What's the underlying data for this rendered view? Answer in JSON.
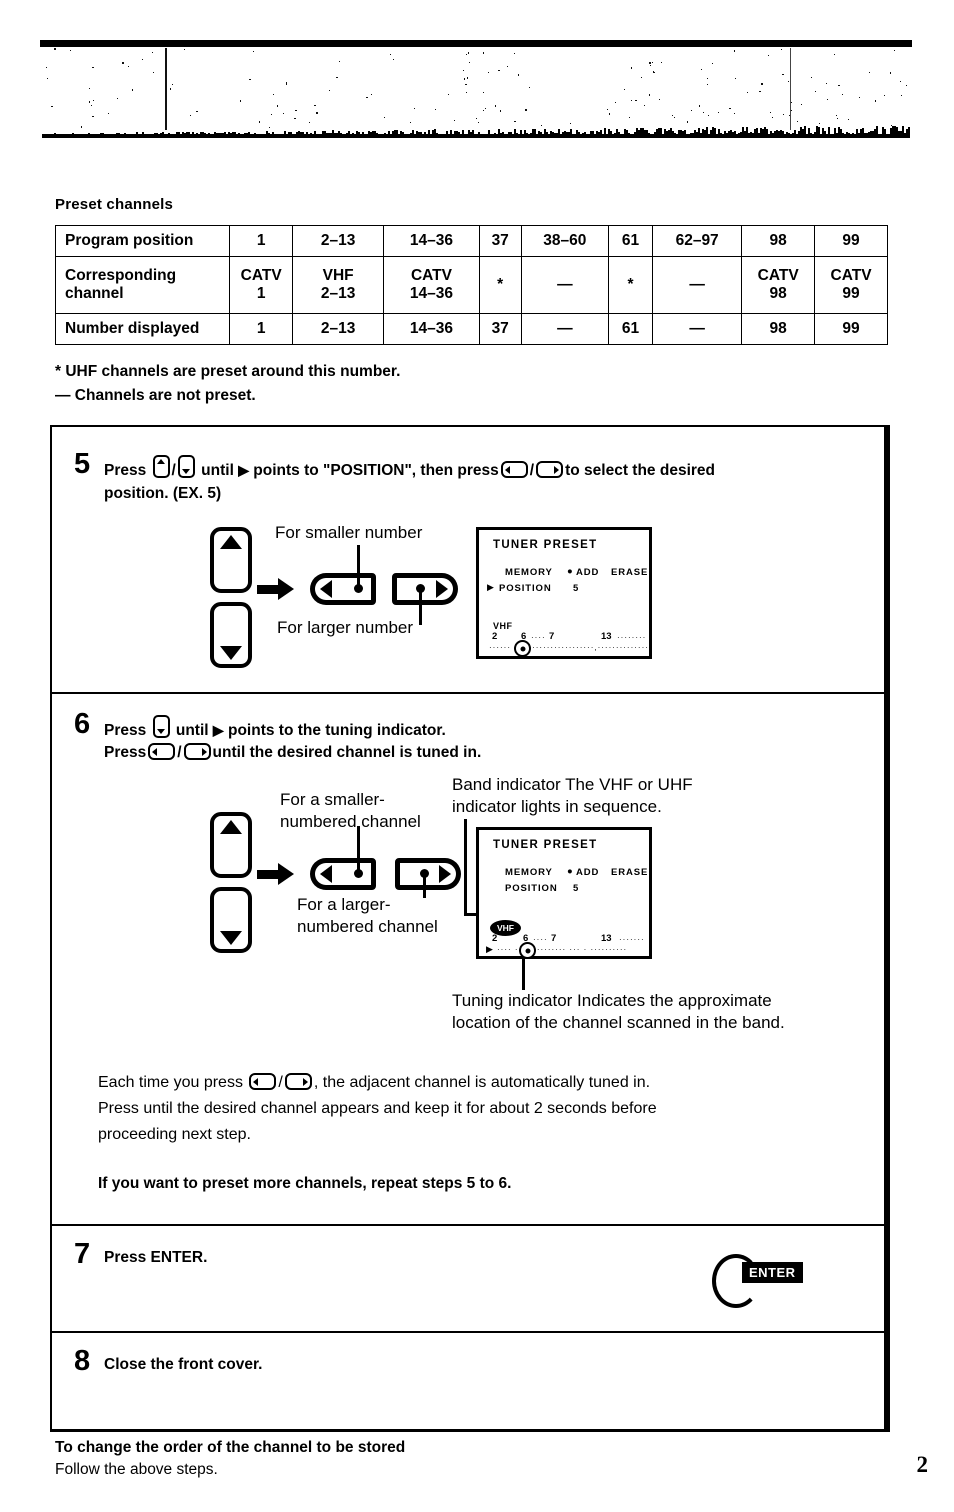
{
  "section": {
    "heading": "Preset channels"
  },
  "preset_table": {
    "rows": [
      {
        "label": "Program position",
        "cells": [
          "1",
          "2–13",
          "14–36",
          "37",
          "38–60",
          "61",
          "62–97",
          "98",
          "99"
        ]
      },
      {
        "label": "Corresponding channel",
        "label_line1": "Corresponding",
        "label_line2": "channel",
        "cells": [
          {
            "line1": "CATV",
            "line2": "1"
          },
          {
            "line1": "VHF",
            "line2": "2–13"
          },
          {
            "line1": "CATV",
            "line2": "14–36"
          },
          {
            "line1": "*",
            "line2": ""
          },
          {
            "line1": "—",
            "line2": ""
          },
          {
            "line1": "*",
            "line2": ""
          },
          {
            "line1": "—",
            "line2": ""
          },
          {
            "line1": "CATV",
            "line2": "98"
          },
          {
            "line1": "CATV",
            "line2": "99"
          }
        ]
      },
      {
        "label": "Number displayed",
        "cells": [
          "1",
          "2–13",
          "14–36",
          "37",
          "—",
          "61",
          "—",
          "98",
          "99"
        ]
      }
    ]
  },
  "footnotes": [
    "*  UHF channels are preset around this number.",
    "— Channels are not preset."
  ],
  "steps": {
    "step5": {
      "number": "5",
      "text_part1": "Press",
      "text_part2": "until",
      "text_part3": "points to \"POSITION\", then press",
      "text_part4": "to select the desired",
      "text_line2": "position. (EX. 5)",
      "caption_smaller": "For smaller number",
      "caption_larger": "For larger number",
      "osd": {
        "title": "TUNER  PRESET",
        "memory_label": "MEMORY",
        "add_label": "ADD",
        "erase_label": "ERASE",
        "position_label": "POSITION",
        "position_value": "5",
        "pointer": "▶",
        "band_label": "VHF",
        "scale": [
          "2",
          "6",
          "7",
          "13"
        ]
      }
    },
    "step6": {
      "number": "6",
      "text_line1_a": "Press",
      "text_line1_b": "until",
      "text_line1_c": "points to the tuning indicator.",
      "text_line2_a": "Press",
      "text_line2_b": "until the desired channel is tuned in.",
      "caption_band": "Band indicator The VHF or UHF\nindicator lights in sequence.",
      "caption_band_line1": "Band indicator The VHF or UHF",
      "caption_band_line2": "indicator lights in sequence.",
      "caption_smaller_line1": "For a smaller-",
      "caption_smaller_line2": "numbered channel",
      "caption_larger_line1": "For a larger-",
      "caption_larger_line2": "numbered channel",
      "caption_tuning_line1": "Tuning indicator Indicates the approximate",
      "caption_tuning_line2": "location of the channel scanned in the band.",
      "osd": {
        "title": "TUNER  PRESET",
        "memory_label": "MEMORY",
        "add_label": "ADD",
        "erase_label": "ERASE",
        "position_label": "POSITION",
        "position_value": "5",
        "pointer": "▶",
        "band_label": "VHF",
        "scale": [
          "2",
          "6",
          "7",
          "13"
        ]
      },
      "paragraph_line1_a": "Each time you press",
      "paragraph_line1_b": ", the adjacent channel is automatically tuned in.",
      "paragraph_line2": "Press until the desired channel appears and keep it for about 2 seconds before",
      "paragraph_line3": "proceeding next step.",
      "note_bold": "If you want to preset more channels, repeat steps 5 to 6."
    },
    "step7": {
      "number": "7",
      "text": "Press ENTER.",
      "enter_label": "ENTER"
    },
    "step8": {
      "number": "8",
      "text": "Close the front cover."
    }
  },
  "footer": {
    "line1": "To change the order of the channel to be stored",
    "line2": "Follow the above steps.",
    "page_number": "2"
  }
}
